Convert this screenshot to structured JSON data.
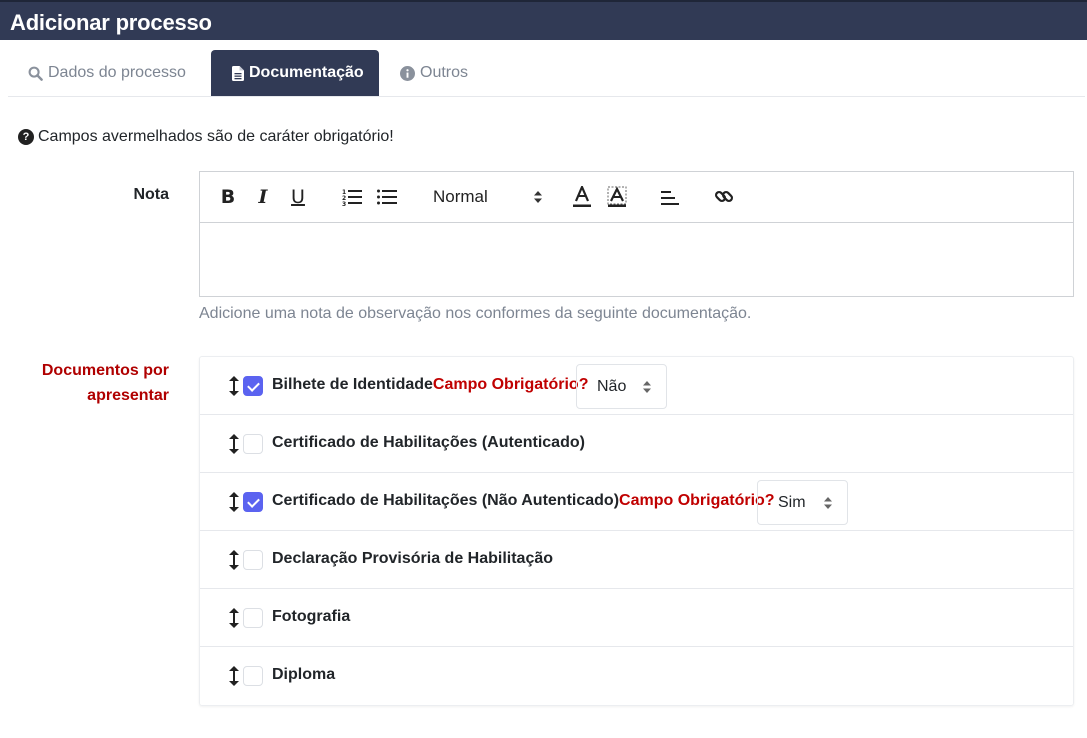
{
  "header": {
    "title": "Adicionar processo"
  },
  "tabs": [
    {
      "label": "Dados do processo",
      "icon": "search-icon",
      "active": false
    },
    {
      "label": "Documentação",
      "icon": "file-icon",
      "active": true
    },
    {
      "label": "Outros",
      "icon": "info-icon",
      "active": false
    }
  ],
  "notice": {
    "icon": "question-circle-icon",
    "text": "Campos avermelhados são de caráter obrigatório!"
  },
  "nota": {
    "label": "Nota",
    "toolbar": {
      "bold": "B",
      "italic": "I",
      "underline": "U",
      "format_select": "Normal",
      "icons": [
        "bold-icon",
        "italic-icon",
        "underline-icon",
        "ordered-list-icon",
        "bullet-list-icon",
        "text-color-icon",
        "background-color-icon",
        "align-icon",
        "link-icon"
      ]
    },
    "value": "",
    "help": "Adicione uma nota de observação nos conformes da seguinte documentação."
  },
  "documents": {
    "label_line1": "Documentos por",
    "label_line2": "apresentar",
    "required_question": "Campo Obrigatório?",
    "items": [
      {
        "name": "Bilhete de Identidade",
        "checked": true,
        "required": "Não"
      },
      {
        "name": "Certificado de Habilitações (Autenticado)",
        "checked": false,
        "required": null
      },
      {
        "name": "Certificado de Habilitações (Não Autenticado)",
        "checked": true,
        "required": "Sim"
      },
      {
        "name": "Declaração Provisória de Habilitação",
        "checked": false,
        "required": null
      },
      {
        "name": "Fotografia",
        "checked": false,
        "required": null
      },
      {
        "name": "Diploma",
        "checked": false,
        "required": null
      }
    ]
  },
  "colors": {
    "header_bg": "#313a55",
    "active_tab_bg": "#313a55",
    "required_red": "#c00000",
    "checkbox_accent": "#5b63f0"
  }
}
